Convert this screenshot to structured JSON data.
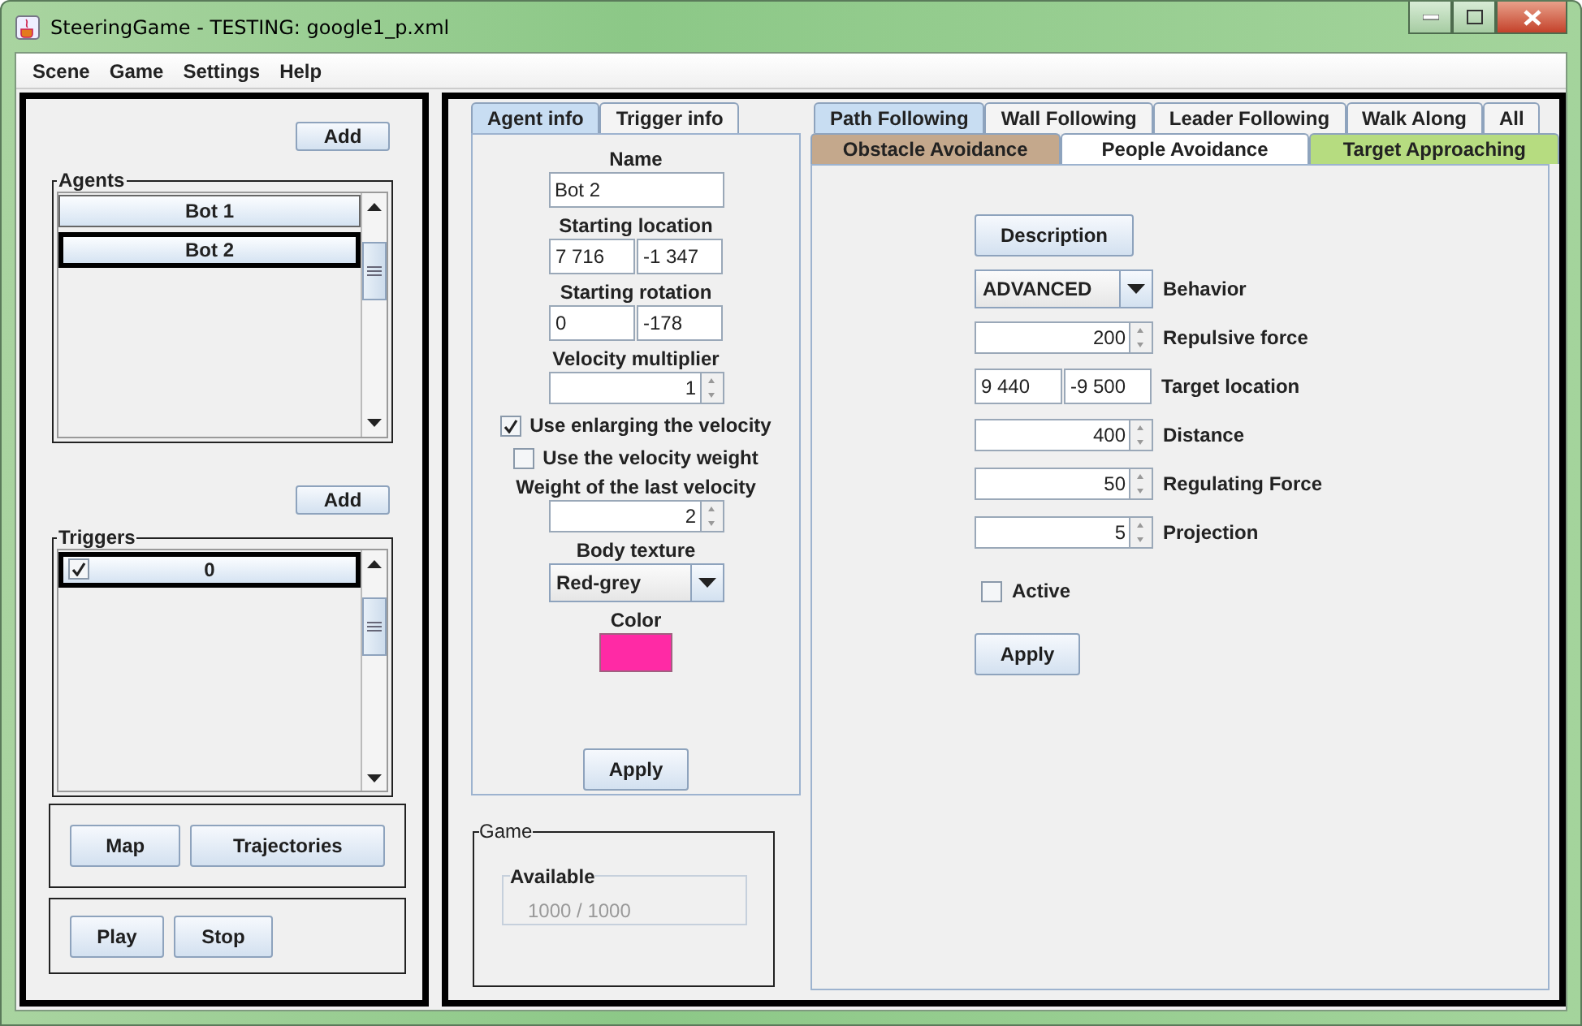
{
  "window": {
    "title": "SteeringGame - TESTING: google1_p.xml"
  },
  "menu": [
    "Scene",
    "Game",
    "Settings",
    "Help"
  ],
  "agents": {
    "add": "Add",
    "title": "Agents",
    "items": [
      {
        "label": "Bot 1",
        "selected": false
      },
      {
        "label": "Bot 2",
        "selected": true
      }
    ]
  },
  "triggers": {
    "add": "Add",
    "title": "Triggers",
    "items": [
      {
        "label": "0",
        "checked": true,
        "selected": true
      }
    ]
  },
  "view_buttons": [
    "Map",
    "Trajectories"
  ],
  "run_buttons": [
    "Play",
    "Stop"
  ],
  "agent_tabs": [
    {
      "label": "Agent info",
      "selected": true
    },
    {
      "label": "Trigger info",
      "selected": false
    }
  ],
  "agent_fields": [
    {
      "kind": "text",
      "label": "Name",
      "value": "Bot 2"
    },
    {
      "kind": "pair",
      "label": "Starting location",
      "values": [
        "7 716",
        "-1 347"
      ]
    },
    {
      "kind": "pair",
      "label": "Starting rotation",
      "values": [
        "0",
        "-178"
      ]
    },
    {
      "kind": "spinner",
      "label": "Velocity multiplier",
      "value": "1"
    },
    {
      "kind": "checkbox",
      "label": "Use enlarging the velocity",
      "checked": true
    },
    {
      "kind": "checkbox",
      "label": "Use the velocity weight",
      "checked": false
    },
    {
      "kind": "spinner",
      "label": "Weight of the last velocity",
      "value": "2"
    },
    {
      "kind": "dropdown",
      "label": "Body texture",
      "value": "Red-grey"
    },
    {
      "kind": "color",
      "label": "Color",
      "color": "#ff2aa5"
    }
  ],
  "agent_apply": "Apply",
  "game": {
    "title": "Game",
    "available_title": "Available",
    "available_value": "1000 / 1000"
  },
  "behavior_tabs": [
    [
      {
        "label": "Path Following",
        "selected": true
      },
      {
        "label": "Wall Following",
        "selected": false
      },
      {
        "label": "Leader Following",
        "selected": false
      },
      {
        "label": "Walk Along",
        "selected": false
      },
      {
        "label": "All",
        "selected": false
      }
    ],
    [
      {
        "label": "Obstacle Avoidance",
        "selected": false,
        "color": "#c4a88c"
      },
      {
        "label": "People Avoidance",
        "selected": false,
        "color": "#ffffff"
      },
      {
        "label": "Target Approaching",
        "selected": false,
        "color": "#b6dc80"
      }
    ]
  ],
  "description": "Description",
  "behavior_fields": [
    {
      "kind": "dropdown",
      "value": "ADVANCED",
      "label": "Behavior"
    },
    {
      "kind": "spinner",
      "value": "200",
      "label": "Repulsive force"
    },
    {
      "kind": "pair",
      "values": [
        "9 440",
        "-9 500"
      ],
      "label": "Target location"
    },
    {
      "kind": "spinner",
      "value": "400",
      "label": "Distance"
    },
    {
      "kind": "spinner",
      "value": "50",
      "label": "Regulating Force"
    },
    {
      "kind": "spinner",
      "value": "5",
      "label": "Projection"
    },
    {
      "kind": "checkbox",
      "label": "Active",
      "checked": false
    }
  ],
  "behavior_apply": "Apply"
}
